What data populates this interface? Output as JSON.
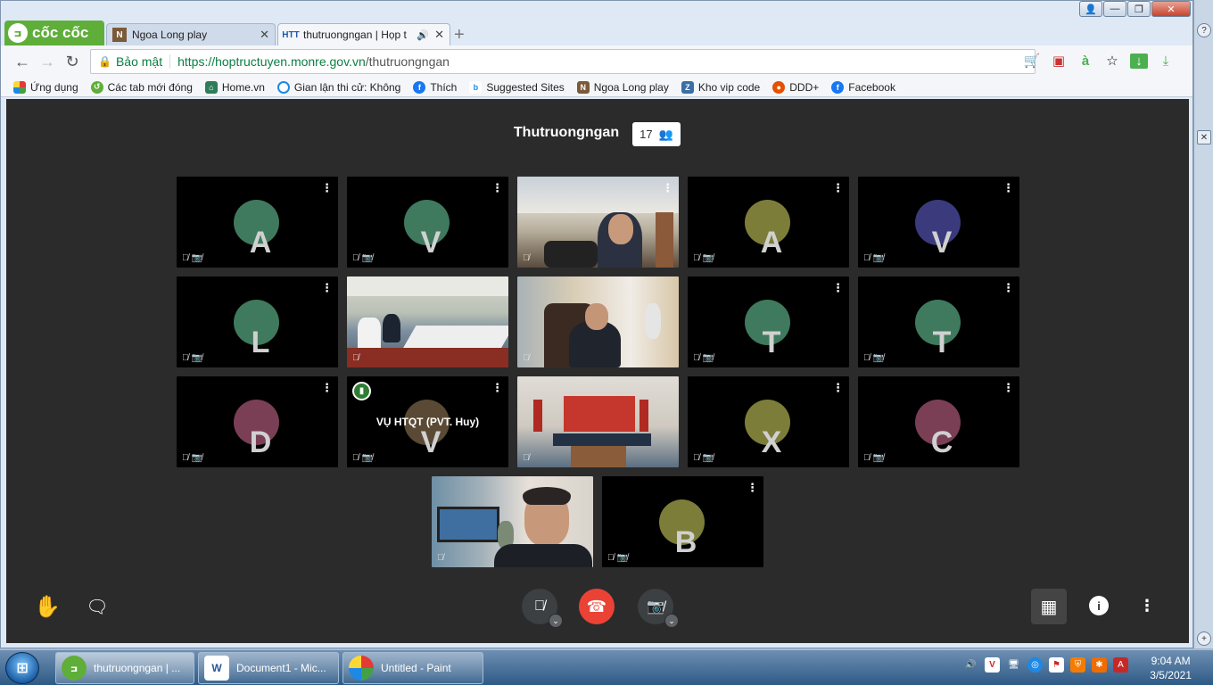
{
  "browser": {
    "brand": "cốc cốc",
    "tabs": [
      {
        "label": "Ngoa Long play",
        "favicon": "ninja-avatar-icon",
        "active": false
      },
      {
        "label": "thutruongngan | Họp t",
        "favicon": "HTT",
        "active": true
      }
    ],
    "security_label": "Bảo mật",
    "url_scheme_host": "https://hoptructuyen.monre.gov.vn",
    "url_path": "/thutruongngan",
    "bookmarks": [
      {
        "label": "Ứng dụng",
        "icon": "apps-grid-icon"
      },
      {
        "label": "Các tab mới đóng",
        "icon": "history-icon"
      },
      {
        "label": "Home.vn",
        "icon": "home-icon"
      },
      {
        "label": "Gian lận thi cử: Không",
        "icon": "circle-icon"
      },
      {
        "label": "Thích",
        "icon": "facebook-icon"
      },
      {
        "label": "Suggested Sites",
        "icon": "bing-icon"
      },
      {
        "label": "Ngoa Long play",
        "icon": "ninja-avatar-icon"
      },
      {
        "label": "Kho vip code",
        "icon": "code-icon"
      },
      {
        "label": "DDD+",
        "icon": "balloon-icon"
      },
      {
        "label": "Facebook",
        "icon": "facebook-icon"
      }
    ]
  },
  "meeting": {
    "room_name": "Thutruongngan",
    "participant_count": "17",
    "tiles": [
      {
        "type": "avatar",
        "initial": "A",
        "color": "#3f7a5e"
      },
      {
        "type": "avatar",
        "initial": "V",
        "color": "#3f7a5e"
      },
      {
        "type": "video",
        "scene": "man-office"
      },
      {
        "type": "avatar",
        "initial": "A",
        "color": "#7d7d3a"
      },
      {
        "type": "avatar",
        "initial": "V",
        "color": "#3a3a7d"
      },
      {
        "type": "avatar",
        "initial": "L",
        "color": "#3f7a5e"
      },
      {
        "type": "video",
        "scene": "meeting-room"
      },
      {
        "type": "video",
        "scene": "man-desk"
      },
      {
        "type": "avatar",
        "initial": "T",
        "color": "#3f7a5e"
      },
      {
        "type": "avatar",
        "initial": "T",
        "color": "#3f7a5e"
      },
      {
        "type": "avatar",
        "initial": "D",
        "color": "#7a3f55"
      },
      {
        "type": "speaking",
        "initial": "V",
        "color": "#5a4a35",
        "name": "VỤ HTQT (PVT. Huy)"
      },
      {
        "type": "video",
        "scene": "conference-hall"
      },
      {
        "type": "avatar",
        "initial": "X",
        "color": "#7d7d3a"
      },
      {
        "type": "avatar",
        "initial": "C",
        "color": "#7a3f55"
      },
      {
        "type": "video",
        "scene": "man-closeup"
      },
      {
        "type": "avatar",
        "initial": "B",
        "color": "#7d7d3a"
      }
    ]
  },
  "controls": {
    "raise_hand": "hand-icon",
    "chat": "chat-icon",
    "mic": "mic-muted-icon",
    "hangup": "hangup-icon",
    "camera": "camera-off-icon",
    "tile_view": "tile-view-icon",
    "info": "info-icon",
    "more": "more-icon"
  },
  "taskbar": {
    "items": [
      {
        "label": "thutruongngan | ...",
        "icon": "coccoc-icon",
        "active": true
      },
      {
        "label": "Document1 - Mic...",
        "icon": "word-icon",
        "active": false
      },
      {
        "label": "Untitled - Paint",
        "icon": "paint-icon",
        "active": false
      }
    ],
    "time": "9:04 AM",
    "date": "3/5/2021"
  }
}
